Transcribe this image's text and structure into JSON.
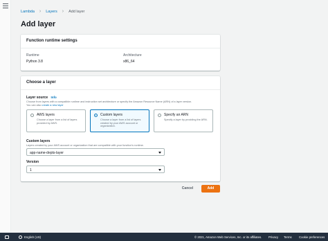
{
  "breadcrumb": [
    {
      "label": "Lambda"
    },
    {
      "label": "Layers"
    },
    {
      "label": "Add layer"
    }
  ],
  "page": {
    "title": "Add layer"
  },
  "runtime_panel": {
    "title": "Function runtime settings",
    "runtime_label": "Runtime",
    "runtime_value": "Python 3.8",
    "arch_label": "Architecture",
    "arch_value": "x86_64"
  },
  "layer_panel": {
    "title": "Choose a layer",
    "layer_source_label": "Layer source",
    "info_label": "Info",
    "description": "Choose from layers with a compatible runtime and instruction set architecture or specify the Amazon Resource Name (ARN) of a layer version.",
    "description2": "You can also",
    "create_link": "create a new layer",
    "options": [
      {
        "title": "AWS layers",
        "desc": "Choose a layer from a list of layers provided by AWS."
      },
      {
        "title": "Custom layers",
        "desc": "Choose a layer from a list of layers created by your AWS account or organization."
      },
      {
        "title": "Specify an ARN",
        "desc": "Specify a layer by providing the ARN."
      }
    ],
    "selected_option": "Custom layers",
    "custom_layers_label": "Custom layers",
    "custom_layers_desc": "Layers created by your AWS account or organization that are compatible with your function's runtime.",
    "custom_layers_value": "app-name-depts-layer",
    "version_label": "Version",
    "version_value": "1"
  },
  "actions": {
    "cancel": "Cancel",
    "add": "Add"
  },
  "footer": {
    "feedback": "Feedback",
    "language": "English (US)",
    "copyright": "© 2021, Amazon Web Services, Inc. or its affiliates.",
    "privacy": "Privacy",
    "terms": "Terms",
    "cookies": "Cookie preferences"
  },
  "colors": {
    "accent": "#0073bb",
    "primary_button": "#ec7211",
    "footer_bg": "#232f3e"
  }
}
